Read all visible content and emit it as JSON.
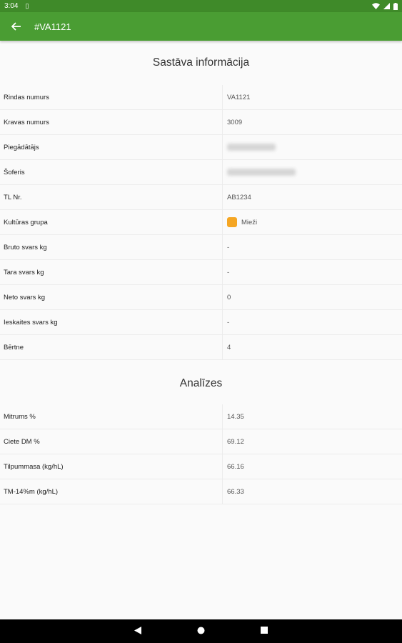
{
  "status": {
    "time": "3:04"
  },
  "header": {
    "title": "#VA1121"
  },
  "composition": {
    "title": "Sastāva informācija",
    "rows": [
      {
        "label": "Rindas numurs",
        "value": "VA1121"
      },
      {
        "label": "Kravas numurs",
        "value": "3009"
      },
      {
        "label": "Piegādātājs",
        "value": ""
      },
      {
        "label": "Šoferis",
        "value": ""
      },
      {
        "label": "TL Nr.",
        "value": "AB1234"
      },
      {
        "label": "Kultūras grupa",
        "value": "Mieži"
      },
      {
        "label": "Bruto svars kg",
        "value": "-"
      },
      {
        "label": "Tara svars kg",
        "value": "-"
      },
      {
        "label": "Neto svars kg",
        "value": "0"
      },
      {
        "label": "Ieskaites svars kg",
        "value": "-"
      },
      {
        "label": "Bērtne",
        "value": "4"
      }
    ]
  },
  "analyses": {
    "title": "Analīzes",
    "rows": [
      {
        "label": "Mitrums %",
        "value": "14.35"
      },
      {
        "label": "Ciete DM %",
        "value": "69.12"
      },
      {
        "label": "Tilpummasa (kg/hL)",
        "value": "66.16"
      },
      {
        "label": "TM-14%m (kg/hL)",
        "value": "66.33"
      }
    ]
  },
  "colors": {
    "status_bar": "#3f8a29",
    "app_bar": "#4a9d33",
    "culture_swatch": "#f5a623"
  },
  "icons": {
    "back": "arrow-left-icon",
    "wifi": "wifi-icon",
    "battery": "battery-icon",
    "nav_back": "triangle-back-icon",
    "nav_home": "circle-home-icon",
    "nav_recent": "square-recent-icon"
  }
}
